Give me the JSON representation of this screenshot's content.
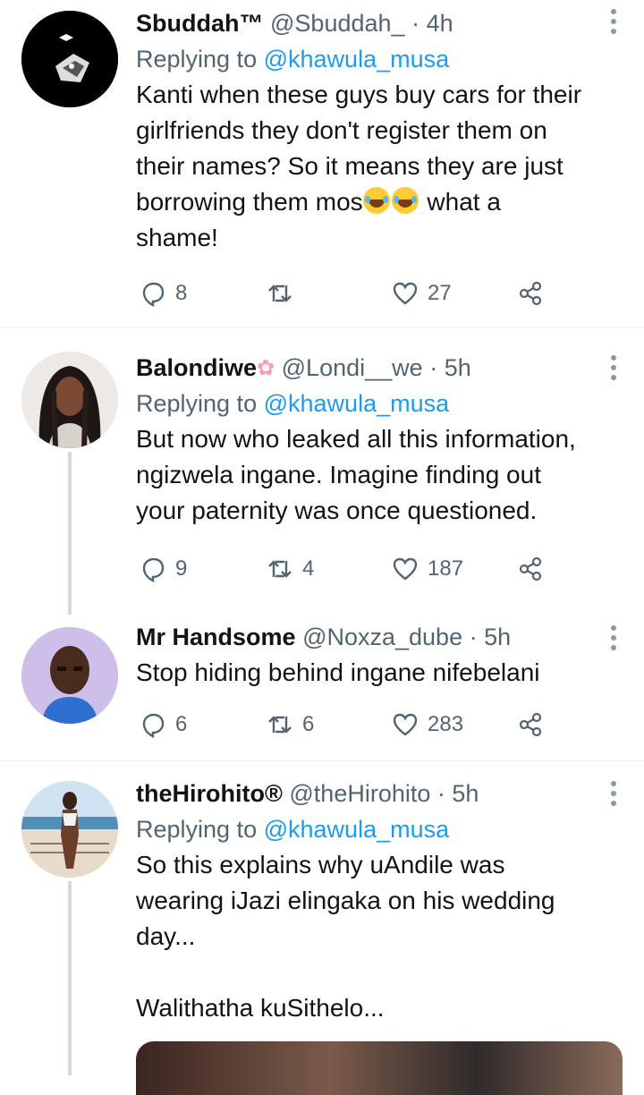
{
  "tweets": [
    {
      "name": "Sbuddah™",
      "handle": "@Sbuddah_",
      "time": "4h",
      "replying_prefix": "Replying to",
      "replying_to": "@khawula_musa",
      "text_lines": [
        "Kanti when these guys buy cars for their",
        "girlfriends they don't register them on",
        "their names? So it means they are just",
        "borrowing them mos",
        "shame!"
      ],
      "text_line4_suffix": " what a",
      "emojis": [
        "face-with-tears-of-joy",
        "face-with-tears-of-joy"
      ],
      "replies": "8",
      "retweets": "",
      "likes": "27",
      "avatar_bg": "#000000"
    },
    {
      "name": "Balondiwe",
      "name_emoji": "cherry-blossom",
      "name_emoji_glyph": "✿",
      "handle": "@Londi__we",
      "time": "5h",
      "replying_prefix": "Replying to",
      "replying_to": "@khawula_musa",
      "text_lines": [
        "But now who leaked all this information,",
        "ngizwela ingane. Imagine finding out",
        "your paternity was once questioned."
      ],
      "replies": "9",
      "retweets": "4",
      "likes": "187"
    },
    {
      "name": "Mr Handsome",
      "handle": "@Noxza_dube",
      "time": "5h",
      "text_lines": [
        "Stop hiding behind ingane nifebelani"
      ],
      "replies": "6",
      "retweets": "6",
      "likes": "283"
    },
    {
      "name": "theHirohito®",
      "handle": "@theHirohito",
      "time": "5h",
      "replying_prefix": "Replying to",
      "replying_to": "@khawula_musa",
      "text_lines": [
        "So this explains why uAndile was",
        "wearing iJazi elingaka on his wedding",
        "day...",
        "",
        "Walithatha kuSithelo..."
      ]
    }
  ],
  "separator": "·",
  "icons": {
    "reply": "reply-icon",
    "retweet": "retweet-icon",
    "like": "heart-icon",
    "share": "share-icon",
    "more": "more-vertical-icon"
  },
  "colors": {
    "link": "#1d9bf0",
    "secondary": "#536471",
    "text": "#0f1419",
    "thread": "#cfd9de"
  }
}
